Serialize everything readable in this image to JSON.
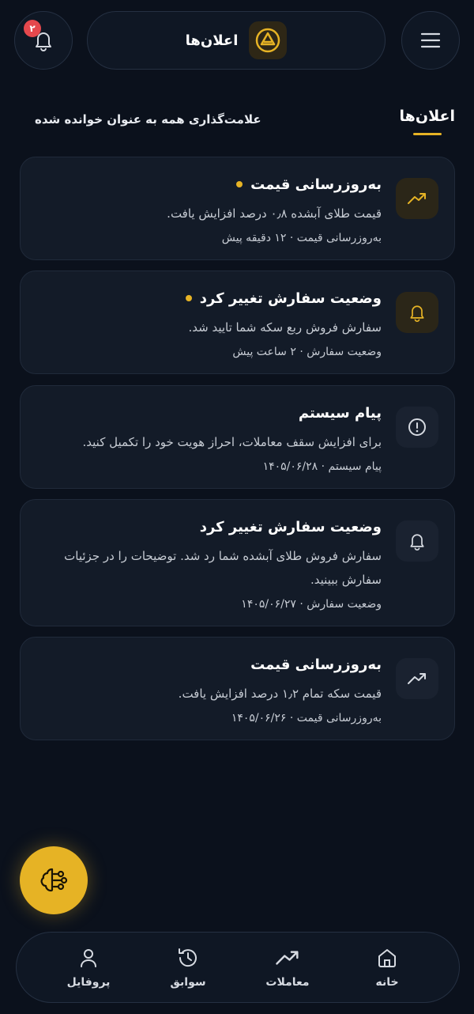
{
  "header": {
    "title": "اعلان‌ها",
    "notification_count": "۲",
    "menu_icon": "hamburger-menu-icon",
    "bell_icon": "bell-icon",
    "logo_icon": "brand-logo-icon"
  },
  "tabs": {
    "active_label": "اعلان‌ها",
    "mark_all_read": "علامت‌گذاری همه به عنوان خوانده شده"
  },
  "colors": {
    "accent": "#e6b325",
    "background": "#0b111c",
    "card": "#131b28",
    "badge": "#e5484d"
  },
  "notifications": [
    {
      "icon": "trending-up-icon",
      "title": "به‌روزرسانی قیمت",
      "unread": true,
      "message": "قیمت طلای آبشده ۰٫۸ درصد افزایش یافت.",
      "meta": "به‌روزرسانی قیمت · ۱۲ دقیقه پیش"
    },
    {
      "icon": "bell-icon",
      "title": "وضعیت سفارش تغییر کرد",
      "unread": true,
      "message": "سفارش فروش ربع سکه شما تایید شد.",
      "meta": "وضعیت سفارش · ۲ ساعت پیش"
    },
    {
      "icon": "alert-circle-icon",
      "title": "پیام سیستم",
      "unread": false,
      "message": "برای افزایش سقف معاملات، احراز هویت خود را تکمیل کنید.",
      "meta": "پیام سیستم · ۱۴۰۵/۰۶/۲۸"
    },
    {
      "icon": "bell-icon",
      "title": "وضعیت سفارش تغییر کرد",
      "unread": false,
      "message": "سفارش فروش طلای آبشده شما رد شد. توضیحات را در جزئیات سفارش ببینید.",
      "meta": "وضعیت سفارش · ۱۴۰۵/۰۶/۲۷"
    },
    {
      "icon": "trending-up-icon",
      "title": "به‌روزرسانی قیمت",
      "unread": false,
      "message": "قیمت سکه تمام ۱٫۲ درصد افزایش یافت.",
      "meta": "به‌روزرسانی قیمت · ۱۴۰۵/۰۶/۲۶"
    }
  ],
  "fab": {
    "icon": "ai-brain-icon"
  },
  "bottom_nav": [
    {
      "label": "خانه",
      "icon": "home-icon"
    },
    {
      "label": "معاملات",
      "icon": "trending-up-icon"
    },
    {
      "label": "سوابق",
      "icon": "history-icon"
    },
    {
      "label": "پروفایل",
      "icon": "user-icon"
    }
  ]
}
